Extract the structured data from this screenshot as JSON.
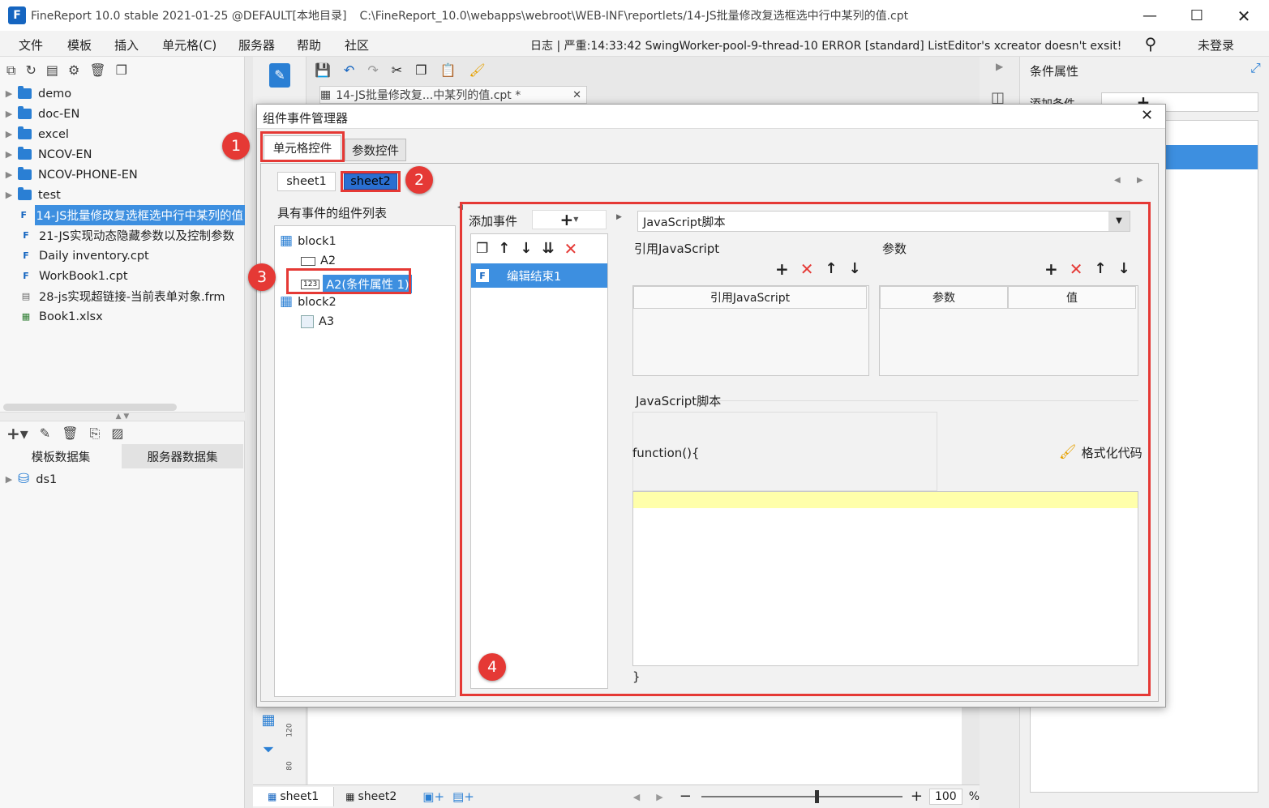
{
  "window": {
    "title": "FineReport 10.0 stable 2021-01-25 @DEFAULT[本地目录]",
    "path": "C:\\FineReport_10.0\\webapps\\webroot\\WEB-INF\\reportlets/14-JS批量修改复选框选中行中某列的值.cpt"
  },
  "menu": {
    "items": [
      "文件",
      "模板",
      "插入",
      "单元格(C)",
      "服务器",
      "帮助",
      "社区"
    ],
    "log": "日志 | 严重:14:33:42 SwingWorker-pool-9-thread-10 ERROR [standard] ListEditor's xcreator doesn't exsit!",
    "login": "未登录"
  },
  "filetree": {
    "folders": [
      "demo",
      "doc-EN",
      "excel",
      "NCOV-EN",
      "NCOV-PHONE-EN",
      "test"
    ],
    "files": [
      "14-JS批量修改复选框选中行中某列的值",
      "21-JS实现动态隐藏参数以及控制参数",
      "Daily inventory.cpt",
      "WorkBook1.cpt",
      "28-js实现超链接-当前表单对象.frm",
      "Book1.xlsx"
    ]
  },
  "dataset": {
    "tabs": [
      "模板数据集",
      "服务器数据集"
    ],
    "items": [
      "ds1"
    ]
  },
  "editor": {
    "tab_label": "14-JS批量修改复...中某列的值.cpt *",
    "sheets": [
      "sheet1",
      "sheet2"
    ],
    "zoom": "100",
    "zoom_unit": "%",
    "ruler_120": "120",
    "ruler_80": "80"
  },
  "right": {
    "title": "条件属性",
    "add_condition": "添加条件"
  },
  "dialog": {
    "title": "组件事件管理器",
    "tabs": [
      "单元格控件",
      "参数控件"
    ],
    "sheets": [
      "sheet1",
      "sheet2"
    ],
    "widget_list_title": "具有事件的组件列表",
    "widget_tree": {
      "block1": "block1",
      "a2": "A2",
      "a2_cond": "A2(条件属性 1)",
      "block2": "block2",
      "a3": "A3"
    },
    "add_event": "添加事件",
    "event_item": "编辑结束1",
    "script_type": "JavaScript脚本",
    "ref_js": "引用JavaScript",
    "params": "参数",
    "col_ref_js": "引用JavaScript",
    "col_param": "参数",
    "col_value": "值",
    "js_script": "JavaScript脚本",
    "function_start": "function(){",
    "format_code": "格式化代码",
    "function_end": "}"
  },
  "annotations": [
    "1",
    "2",
    "3",
    "4"
  ],
  "colors": {
    "accent": "#2a7fd4",
    "highlight": "#e53935",
    "selection": "#3d8fe0"
  }
}
